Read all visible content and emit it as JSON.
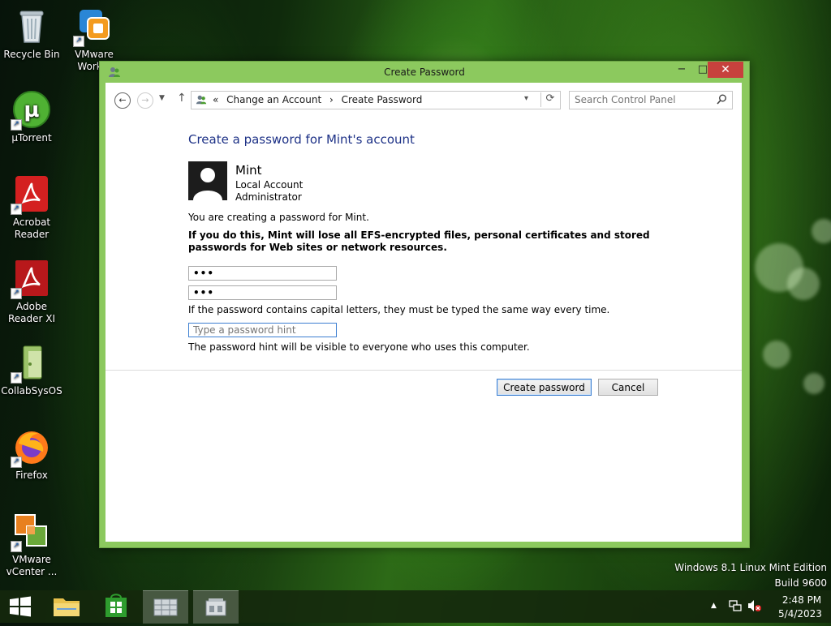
{
  "desktop": {
    "icons": [
      {
        "label": "Recycle Bin",
        "icon": "recycle-bin-icon"
      },
      {
        "label": "VMware Workst",
        "icon": "vmware-workstation-icon"
      },
      {
        "label": "µTorrent",
        "icon": "utorrent-icon"
      },
      {
        "label": "Acrobat Reader",
        "icon": "acrobat-reader-icon"
      },
      {
        "label": "Adobe Reader XI",
        "icon": "adobe-reader-icon"
      },
      {
        "label": "CollabSysOS",
        "icon": "collabsysos-icon"
      },
      {
        "label": "Firefox",
        "icon": "firefox-icon"
      },
      {
        "label": "VMware vCenter ...",
        "icon": "vmware-vcenter-icon"
      }
    ],
    "watermark": {
      "edition": "Windows 8.1 Linux Mint Edition",
      "build": "Build 9600"
    }
  },
  "window": {
    "title": "Create Password",
    "controls": {
      "minimize": "−",
      "maximize": "□",
      "close": "✕"
    },
    "address_bar": {
      "back": "←",
      "forward": "→",
      "up": "↑",
      "prefix": "«",
      "breadcrumbs": [
        "Change an Account",
        "Create Password"
      ],
      "separator": "›",
      "refresh": "⟳"
    },
    "search": {
      "placeholder": "Search Control Panel"
    }
  },
  "page": {
    "heading": "Create a password for Mint's account",
    "account": {
      "name": "Mint",
      "type": "Local Account",
      "role": "Administrator"
    },
    "info_text": "You are creating a password for Mint.",
    "warning_text": "If you do this, Mint will lose all EFS-encrypted files, personal certificates and stored passwords for Web sites or network resources.",
    "new_password": "abc",
    "confirm_password": "abc",
    "caps_note": "If the password contains capital letters, they must be typed the same way every time.",
    "hint": {
      "value": "",
      "placeholder": "Type a password hint"
    },
    "hint_note": "The password hint will be visible to everyone who uses this computer.",
    "buttons": {
      "create": "Create password",
      "cancel": "Cancel"
    }
  },
  "taskbar": {
    "items": [
      "start-button",
      "file-explorer",
      "windows-store",
      "control-panel",
      "user-accounts"
    ],
    "clock": {
      "time": "2:48 PM",
      "date": "5/4/2023"
    }
  },
  "colors": {
    "window_frame": "#8cc95e",
    "heading": "#1e3287",
    "close_button": "#c7413d",
    "focus_blue": "#3c7fd1"
  }
}
